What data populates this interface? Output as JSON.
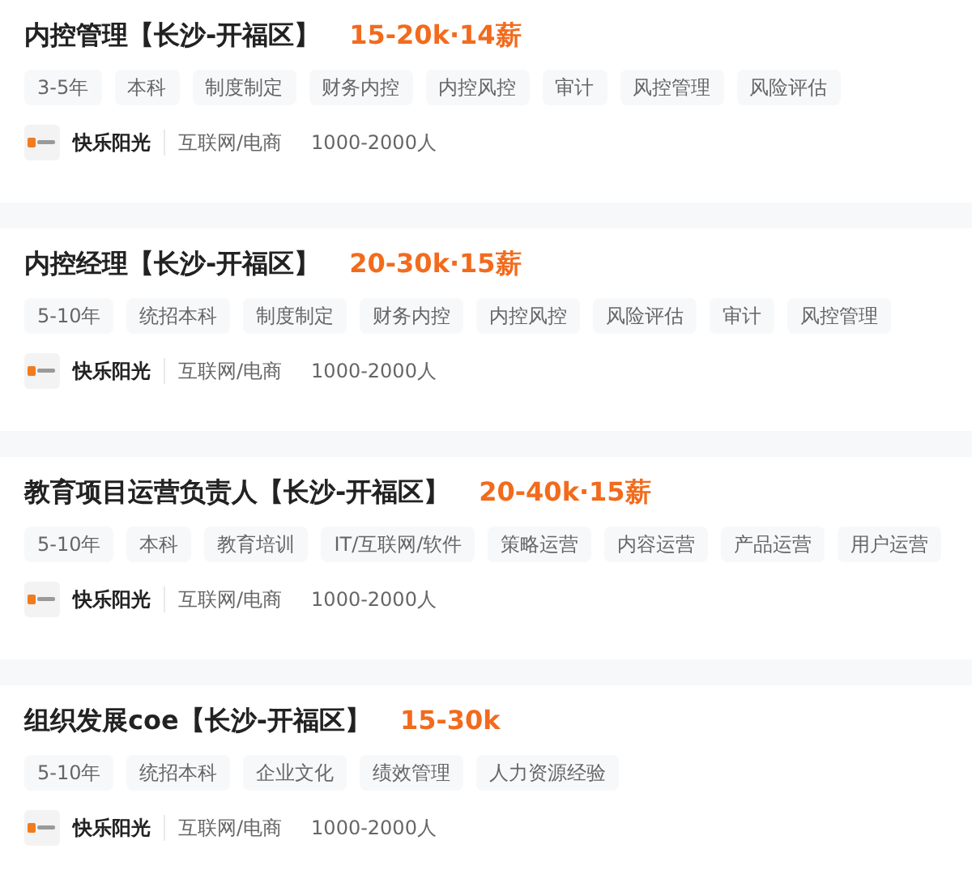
{
  "jobs": [
    {
      "title": "内控管理【长沙-开福区】",
      "salary": "15-20k·14薪",
      "tags": [
        "3-5年",
        "本科",
        "制度制定",
        "财务内控",
        "内控风控",
        "审计",
        "风控管理",
        "风险评估"
      ],
      "company": "快乐阳光",
      "industry": "互联网/电商",
      "size": "1000-2000人"
    },
    {
      "title": "内控经理【长沙-开福区】",
      "salary": "20-30k·15薪",
      "tags": [
        "5-10年",
        "统招本科",
        "制度制定",
        "财务内控",
        "内控风控",
        "风险评估",
        "审计",
        "风控管理"
      ],
      "company": "快乐阳光",
      "industry": "互联网/电商",
      "size": "1000-2000人"
    },
    {
      "title": "教育项目运营负责人【长沙-开福区】",
      "salary": "20-40k·15薪",
      "tags": [
        "5-10年",
        "本科",
        "教育培训",
        "IT/互联网/软件",
        "策略运营",
        "内容运营",
        "产品运营",
        "用户运营"
      ],
      "company": "快乐阳光",
      "industry": "互联网/电商",
      "size": "1000-2000人"
    },
    {
      "title": "组织发展coe【长沙-开福区】",
      "salary": "15-30k",
      "tags": [
        "5-10年",
        "统招本科",
        "企业文化",
        "绩效管理",
        "人力资源经验"
      ],
      "company": "快乐阳光",
      "industry": "互联网/电商",
      "size": "1000-2000人"
    }
  ]
}
